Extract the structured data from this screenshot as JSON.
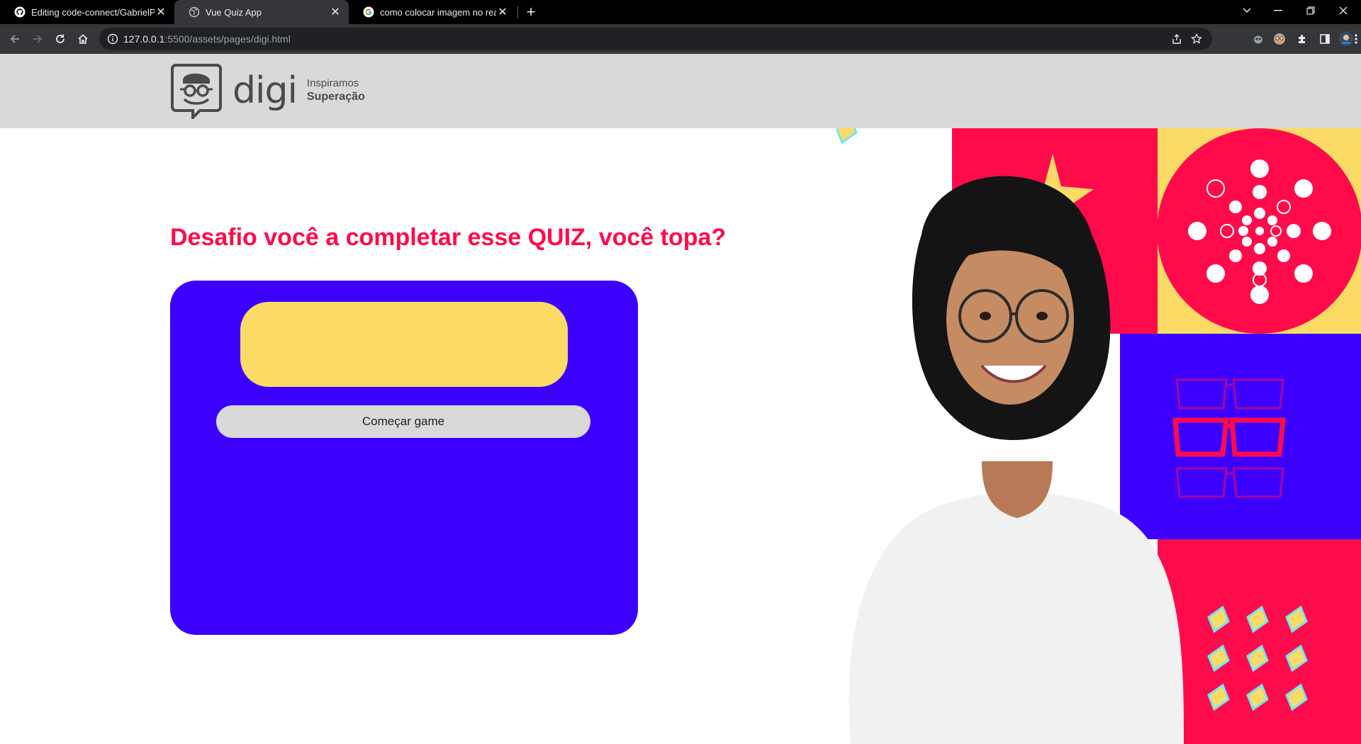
{
  "browser": {
    "tabs": [
      {
        "title": "Editing code-connect/GabrielPro",
        "icon": "github-icon",
        "active": false
      },
      {
        "title": "Vue Quiz App",
        "icon": "globe-icon",
        "active": true
      },
      {
        "title": "como colocar imagem no readm",
        "icon": "google-icon",
        "active": false
      }
    ],
    "url_host": "127.0.0.1",
    "url_rest": ":5500/assets/pages/digi.html"
  },
  "site": {
    "logo_word": "digi",
    "tagline_line1": "Inspiramos",
    "tagline_line2": "Superação"
  },
  "main": {
    "headline": "Desafio você a completar esse QUIZ, você topa?",
    "question_text": "",
    "start_button": "Começar game"
  },
  "colors": {
    "headline": "#ff0b4c",
    "card": "#3c00ff",
    "question_box": "#fbdb66",
    "button": "#d9d9d9",
    "header": "#d9d9d9",
    "hero_red": "#ff0b4c",
    "hero_yellow": "#fbdb66",
    "hero_blue": "#3c00ff"
  }
}
